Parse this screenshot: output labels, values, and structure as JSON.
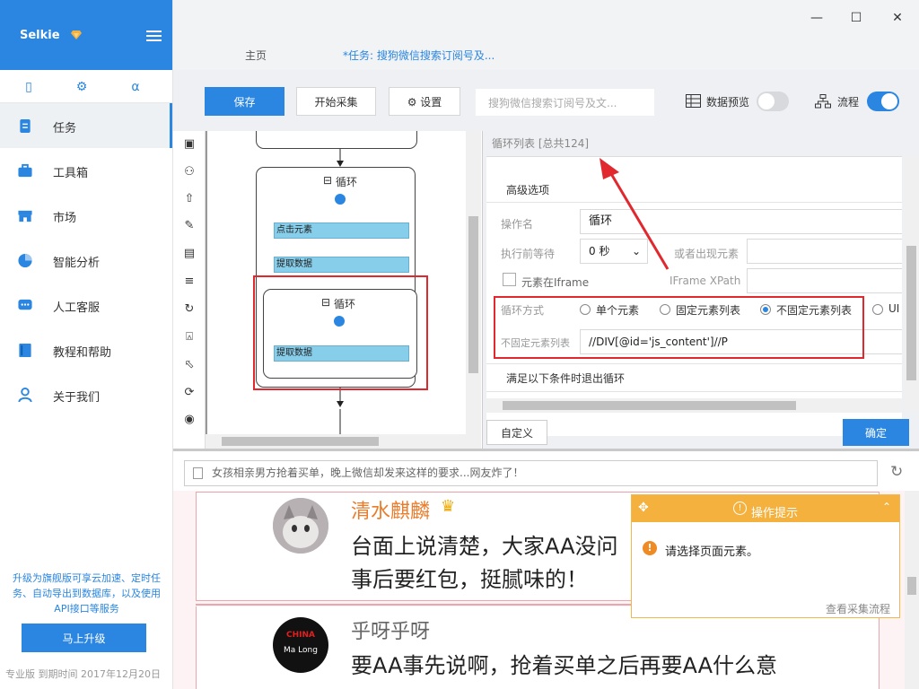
{
  "app": {
    "brand": "Selkie"
  },
  "sidebar": {
    "nav": [
      {
        "label": "任务"
      },
      {
        "label": "工具箱"
      },
      {
        "label": "市场"
      },
      {
        "label": "智能分析"
      },
      {
        "label": "人工客服"
      },
      {
        "label": "教程和帮助"
      },
      {
        "label": "关于我们"
      }
    ],
    "promo_text": "升级为旗舰版可享云加速、定时任务、自动导出到数据库，以及使用API接口等服务",
    "upgrade_label": "马上升级",
    "version_text": "专业版  到期时间 2017年12月20日"
  },
  "tabs": {
    "home": "主页",
    "task": "*任务: 搜狗微信搜索订阅号及..."
  },
  "toolbar": {
    "save": "保存",
    "start": "开始采集",
    "settings": "设置",
    "task_name": "搜狗微信搜索订阅号及文...",
    "data_preview": "数据预览",
    "flow": "流程",
    "data_preview_on": false,
    "flow_on": true
  },
  "workflow": {
    "loop_outer": "循环",
    "click_element": "点击元素",
    "extract_data_1": "提取数据",
    "loop_inner": "循环",
    "extract_data_2": "提取数据"
  },
  "panel": {
    "list_title": "循环列表 [总共124]",
    "advanced": "高级选项",
    "op_name_label": "操作名",
    "op_name_value": "循环",
    "wait_label": "执行前等待",
    "wait_value": "0 秒",
    "appear_label": "或者出现元素",
    "iframe_label": "元素在Iframe",
    "iframe_xpath_label": "IFrame XPath",
    "loop_mode_label": "循环方式",
    "loop_modes": [
      "单个元素",
      "固定元素列表",
      "不固定元素列表",
      "UI"
    ],
    "selected_mode": "不固定元素列表",
    "xpath_label": "不固定元素列表",
    "xpath_value": "//DIV[@id='js_content']//P",
    "exit_condition": "满足以下条件时退出循环",
    "custom_btn": "自定义",
    "ok_btn": "确定"
  },
  "browser": {
    "url_text": "女孩相亲男方抢着买单，晚上微信却发来这样的要求...网友炸了！",
    "post1": {
      "user": "清水麒麟",
      "line1": "台面上说清楚，大家AA没问",
      "line2": "事后要红包，挺腻味的！"
    },
    "post2": {
      "user": "乎呀乎呀",
      "avatar_text_1": "CHINA",
      "avatar_text_2": "Ma Long",
      "line1": "要AA事先说啊，抢着买单之后再要AA什么意"
    }
  },
  "tooltip": {
    "title": "操作提示",
    "message": "请选择页面元素。",
    "link": "查看采集流程"
  },
  "colors": {
    "accent": "#2a86e0",
    "warning": "#f5b13e",
    "highlight": "#e0282e"
  }
}
